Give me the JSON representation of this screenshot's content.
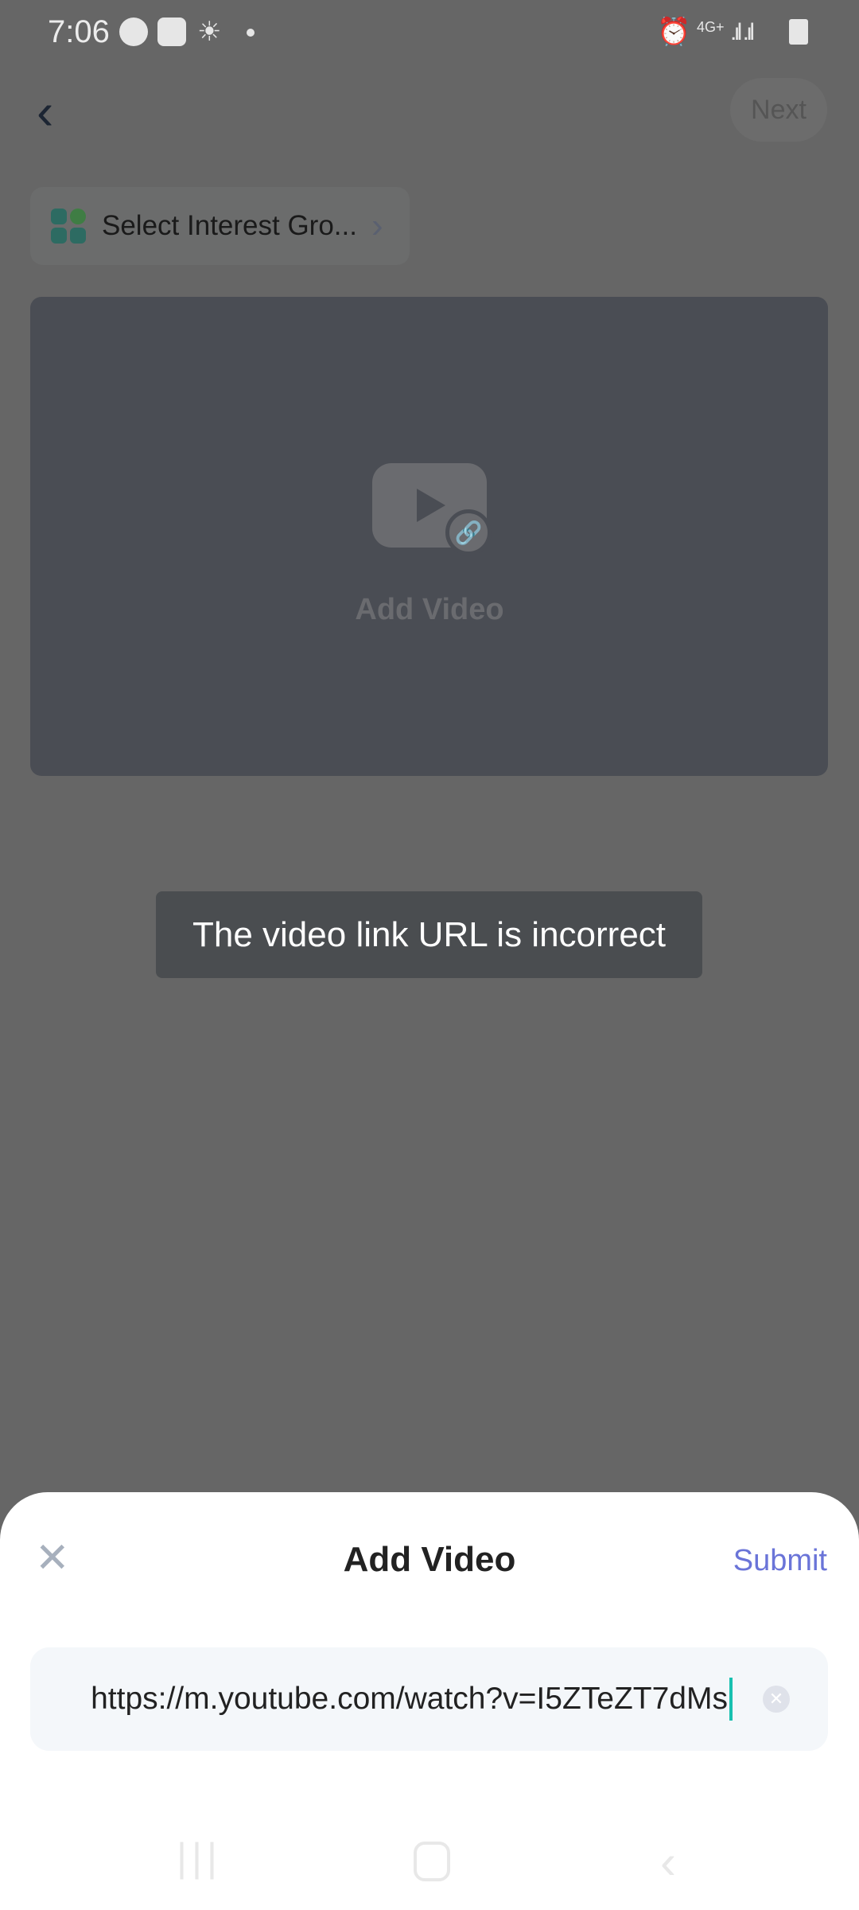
{
  "status_bar": {
    "time": "7:06",
    "network": "4G+",
    "icons": [
      "messenger-icon",
      "app-icon",
      "weather-icon",
      "dot-icon",
      "alarm-icon",
      "signal-icon",
      "signal-icon",
      "battery-icon"
    ]
  },
  "header": {
    "back_icon": "chevron-left-icon",
    "next_label": "Next"
  },
  "interest_group": {
    "label": "Select Interest Gro...",
    "icon": "grid-icon"
  },
  "video_card": {
    "label": "Add Video",
    "icon": "video-link-icon"
  },
  "toast": {
    "message": "The video link URL is incorrect"
  },
  "sheet": {
    "title": "Add Video",
    "submit_label": "Submit",
    "close_icon": "close-icon",
    "input_value": "https://m.youtube.com/watch?v=I5ZTeZT7dMs",
    "accent": "#6a74d8"
  },
  "nav_bar": {
    "icons": [
      "recents-icon",
      "home-icon",
      "back-icon"
    ]
  }
}
